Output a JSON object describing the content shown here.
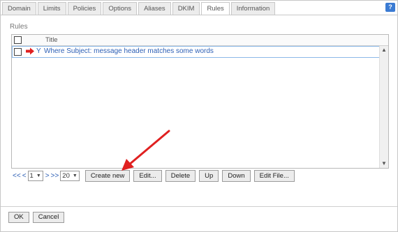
{
  "tabs": [
    "Domain",
    "Limits",
    "Policies",
    "Options",
    "Aliases",
    "DKIM",
    "Rules",
    "Information"
  ],
  "active_tab": "Rules",
  "help_label": "?",
  "section_title": "Rules",
  "grid": {
    "column_title": "Title",
    "rows": [
      {
        "flag": "Y",
        "title": "Where Subject: message header matches some words"
      }
    ]
  },
  "pager": {
    "first": "<<",
    "prev": "<",
    "page": "1",
    "next": ">",
    "last": ">>",
    "page_size": "20"
  },
  "buttons": {
    "create_new": "Create new",
    "edit": "Edit...",
    "delete": "Delete",
    "up": "Up",
    "down": "Down",
    "edit_file": "Edit File..."
  },
  "footer": {
    "ok": "OK",
    "cancel": "Cancel"
  },
  "colors": {
    "link": "#2d5fb5",
    "annotation_arrow": "#e02020",
    "help_badge": "#3b7bd3"
  }
}
